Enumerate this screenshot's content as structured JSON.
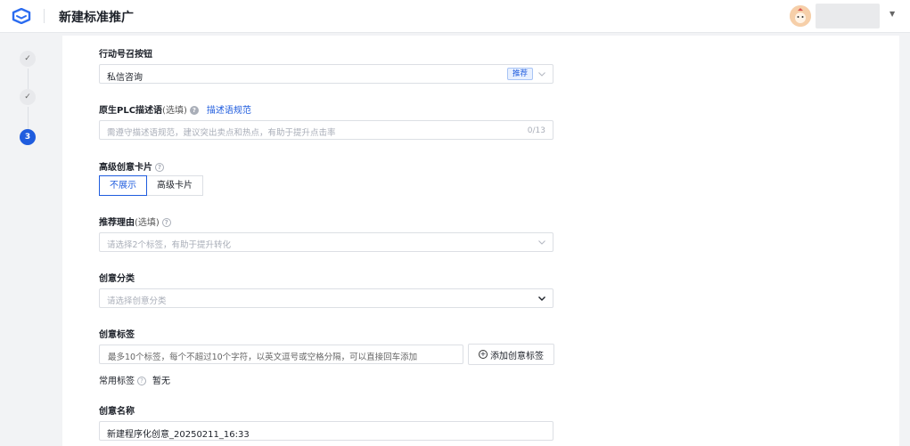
{
  "header": {
    "title": "新建标准推广"
  },
  "steps": [
    {
      "state": "done",
      "label": "✓"
    },
    {
      "state": "done",
      "label": "✓"
    },
    {
      "state": "active",
      "label": "3"
    }
  ],
  "form": {
    "call_button": {
      "label": "行动号召按钮",
      "value": "私信咨询",
      "badge": "推荐"
    },
    "plc_desc": {
      "label": "原生PLC描述语",
      "optional": "(选填)",
      "link": "描述语规范",
      "placeholder": "需遵守描述语规范，建议突出卖点和热点，有助于提升点击率",
      "counter": "0/13"
    },
    "advanced_card": {
      "label": "高级创意卡片",
      "options": [
        "不展示",
        "高级卡片"
      ],
      "selected": "不展示"
    },
    "reason": {
      "label": "推荐理由",
      "optional": "(选填)",
      "placeholder": "请选择2个标签，有助于提升转化"
    },
    "category": {
      "label": "创意分类",
      "placeholder": "请选择创意分类"
    },
    "tags": {
      "label": "创意标签",
      "placeholder": "最多10个标签，每个不超过10个字符，以英文逗号或空格分隔，可以直接回车添加",
      "add_button": "添加创意标签",
      "common_label": "常用标签",
      "common_value": "暂无"
    },
    "name": {
      "label": "创意名称",
      "value": "新建程序化创意_20250211_16:33"
    }
  },
  "colors": {
    "accent": "#1f5cde",
    "border": "#dcdfe4",
    "placeholder": "#a9aeb8"
  }
}
